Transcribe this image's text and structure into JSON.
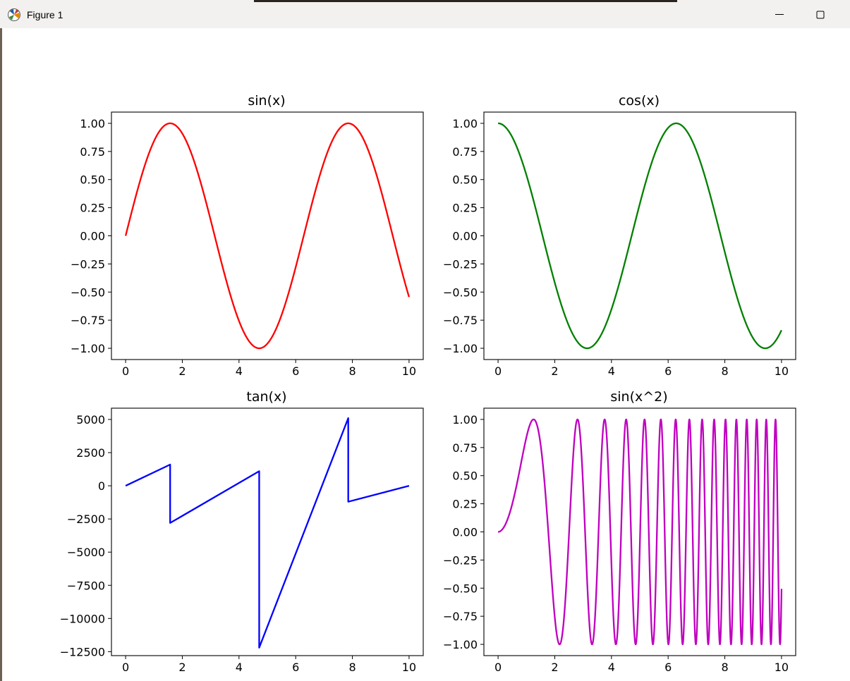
{
  "window": {
    "title": "Figure 1",
    "app_icon": "matplotlib-icon",
    "controls": {
      "minimize_icon": "minimize-icon",
      "maximize_icon": "maximize-icon"
    }
  },
  "chart_data": [
    {
      "type": "line",
      "title": "sin(x)",
      "function": "sin",
      "color": "#ff0000",
      "x_range": [
        0,
        10
      ],
      "xlim": [
        -0.5,
        10.5
      ],
      "ylim": [
        -1.1,
        1.1
      ],
      "xticks": [
        0,
        2,
        4,
        6,
        8,
        10
      ],
      "xtick_labels": [
        "0",
        "2",
        "4",
        "6",
        "8",
        "10"
      ],
      "yticks": [
        1.0,
        0.75,
        0.5,
        0.25,
        0.0,
        -0.25,
        -0.5,
        -0.75,
        -1.0
      ],
      "ytick_labels": [
        "1.00",
        "0.75",
        "0.50",
        "0.25",
        "0.00",
        "−0.25",
        "−0.50",
        "−0.75",
        "−1.00"
      ],
      "series": [
        {
          "x": [
            0,
            1,
            1.571,
            2,
            3,
            4,
            4.712,
            5,
            6,
            7,
            7.854,
            8,
            9,
            10
          ],
          "y": [
            0,
            0.841,
            1.0,
            0.909,
            0.141,
            -0.757,
            -1.0,
            -0.959,
            -0.279,
            0.657,
            1.0,
            0.989,
            0.412,
            -0.544
          ]
        }
      ]
    },
    {
      "type": "line",
      "title": "cos(x)",
      "function": "cos",
      "color": "#008000",
      "x_range": [
        0,
        10
      ],
      "xlim": [
        -0.5,
        10.5
      ],
      "ylim": [
        -1.1,
        1.1
      ],
      "xticks": [
        0,
        2,
        4,
        6,
        8,
        10
      ],
      "xtick_labels": [
        "0",
        "2",
        "4",
        "6",
        "8",
        "10"
      ],
      "yticks": [
        1.0,
        0.75,
        0.5,
        0.25,
        0.0,
        -0.25,
        -0.5,
        -0.75,
        -1.0
      ],
      "ytick_labels": [
        "1.00",
        "0.75",
        "0.50",
        "0.25",
        "0.00",
        "−0.25",
        "−0.50",
        "−0.75",
        "−1.00"
      ],
      "series": [
        {
          "x": [
            0,
            1,
            2,
            3,
            3.142,
            4,
            5,
            6,
            6.283,
            7,
            8,
            9,
            9.425,
            10
          ],
          "y": [
            1.0,
            0.54,
            -0.416,
            -0.99,
            -1.0,
            -0.654,
            0.284,
            0.96,
            1.0,
            0.754,
            -0.146,
            -0.911,
            -1.0,
            -0.839
          ]
        }
      ]
    },
    {
      "type": "line",
      "title": "tan(x)",
      "function": "tan",
      "color": "#0000ff",
      "x_range": [
        0,
        10
      ],
      "xlim": [
        -0.5,
        10.5
      ],
      "ylim": [
        -12800,
        5850
      ],
      "xticks": [
        0,
        2,
        4,
        6,
        8,
        10
      ],
      "xtick_labels": [
        "0",
        "2",
        "4",
        "6",
        "8",
        "10"
      ],
      "yticks": [
        5000,
        2500,
        0,
        -2500,
        -5000,
        -7500,
        -10000,
        -12500
      ],
      "ytick_labels": [
        "5000",
        "2500",
        "0",
        "−2500",
        "−5000",
        "−7500",
        "−10000",
        "−12500"
      ],
      "series": [
        {
          "x": [
            0,
            1.5708,
            1.5708,
            4.7124,
            4.7124,
            7.854,
            7.854,
            10
          ],
          "y": [
            0,
            1600,
            -2800,
            1100,
            -12200,
            5100,
            -1200,
            0.648
          ]
        }
      ]
    },
    {
      "type": "line",
      "title": "sin(x^2)",
      "function": "sinsq",
      "color": "#bf00bf",
      "x_range": [
        0,
        10
      ],
      "xlim": [
        -0.5,
        10.5
      ],
      "ylim": [
        -1.1,
        1.1
      ],
      "xticks": [
        0,
        2,
        4,
        6,
        8,
        10
      ],
      "xtick_labels": [
        "0",
        "2",
        "4",
        "6",
        "8",
        "10"
      ],
      "yticks": [
        1.0,
        0.75,
        0.5,
        0.25,
        0.0,
        -0.25,
        -0.5,
        -0.75,
        -1.0
      ],
      "ytick_labels": [
        "1.00",
        "0.75",
        "0.50",
        "0.25",
        "0.00",
        "−0.25",
        "−0.50",
        "−0.75",
        "−1.00"
      ],
      "series": [
        {
          "x": [
            0,
            1,
            1.253,
            2,
            2.171,
            3,
            4,
            5,
            6,
            7,
            8,
            9,
            10
          ],
          "y": [
            0,
            0.841,
            1.0,
            -0.757,
            -1.0,
            0.412,
            -0.288,
            -0.132,
            -0.992,
            -0.954,
            0.92,
            -0.629,
            -0.506
          ]
        }
      ]
    }
  ]
}
